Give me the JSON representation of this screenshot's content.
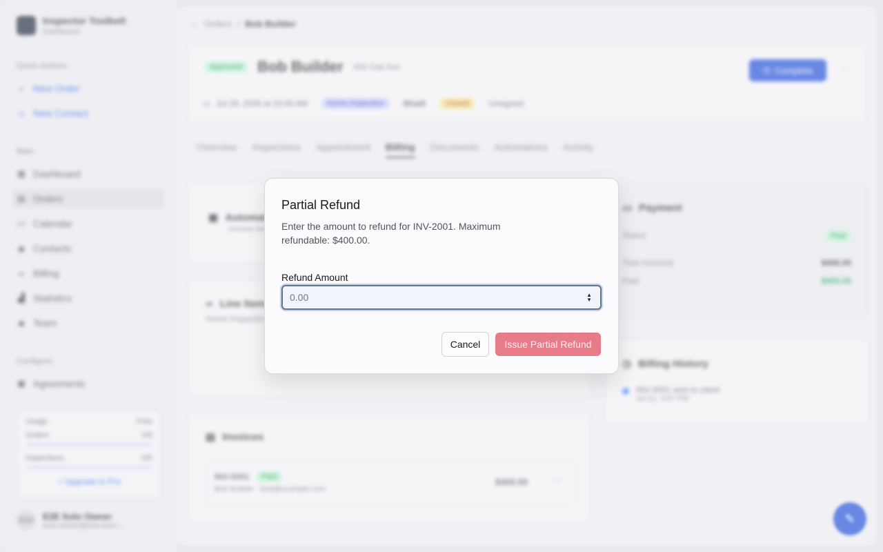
{
  "sidebar": {
    "brand_name": "Inspector Toolbelt",
    "brand_sub": "Dashboard",
    "quick_actions_label": "Quick Actions",
    "quick_actions": [
      "New Order",
      "New Contact"
    ],
    "main_label": "Main",
    "main_items": [
      "Dashboard",
      "Orders",
      "Calendar",
      "Contacts",
      "Billing",
      "Statistics",
      "Team"
    ],
    "configure_label": "Configure",
    "configure_items": [
      "Agreements"
    ],
    "usage": {
      "label": "Usage",
      "plan": "Free",
      "orders_label": "Orders",
      "orders_value": "0/5",
      "inspections_label": "Inspections",
      "inspections_value": "0/5",
      "upgrade": "+ Upgrade to Pro"
    },
    "user": {
      "initials": "ESO",
      "name": "E2E Solo Owner",
      "email": "solo.owner@e2e.test.i..."
    }
  },
  "breadcrumb": {
    "parent": "Orders",
    "current": "Bob Builder"
  },
  "order": {
    "status": "Approved",
    "client": "Bob Builder",
    "address": "456 Oak Ave",
    "complete_label": "Complete",
    "datetime": "Jul 28, 2026 at 10:00 AM",
    "type": "Home Inspection",
    "assignee": "Bhaili",
    "payment_state": "Unpaid",
    "extra": "Unsigned"
  },
  "tabs": [
    "Overview",
    "Inspections",
    "Appointment",
    "Billing",
    "Documents",
    "Automations",
    "Activity"
  ],
  "cards": {
    "automations_title": "Automations",
    "automations_sub": "Invoice reminders",
    "line_items_title": "Line Items",
    "line_items_sub": "Home Inspection",
    "invoices_title": "Invoices",
    "invoice_number": "INV-2001",
    "invoice_status": "Paid",
    "invoice_meta": "Bob Builder · bob@example.com",
    "invoice_amount": "$400.00",
    "payment_title": "Payment",
    "payment_status_label": "Status",
    "payment_status": "Paid",
    "total_invoiced_label": "Total Invoiced",
    "total_invoiced": "$400.00",
    "paid_label": "Paid",
    "paid": "$400.00",
    "history_title": "Billing History",
    "history_entry": "INV-2001 sent to client",
    "history_time": "Jul 21, 4:07 PM"
  },
  "dialog": {
    "title": "Partial Refund",
    "description": "Enter the amount to refund for INV-2001. Maximum refundable: $400.00.",
    "amount_label": "Refund Amount",
    "amount_placeholder": "0.00",
    "cancel_label": "Cancel",
    "submit_label": "Issue Partial Refund"
  },
  "colors": {
    "accent": "#1d4ed8",
    "destructive_disabled": "#e87b88"
  }
}
